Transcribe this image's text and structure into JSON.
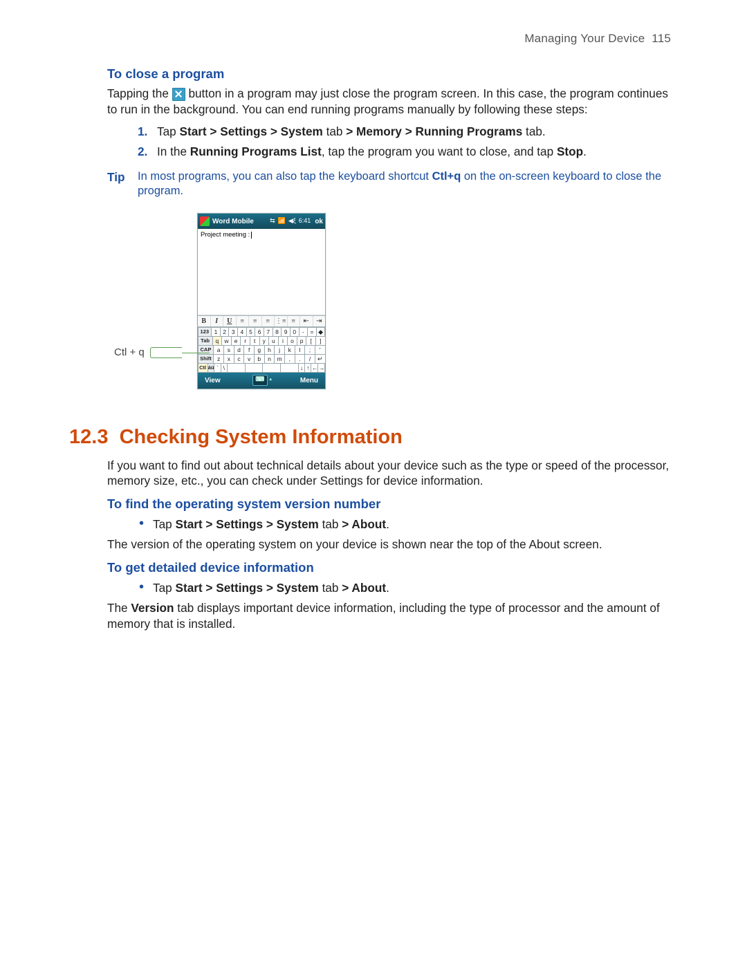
{
  "header": {
    "section": "Managing Your Device",
    "page_no": "115"
  },
  "s1": {
    "title": "To close a program",
    "para_a": "Tapping the ",
    "para_b": " button in a program may just close the program screen. In this case, the program continues to run in the background. You can end running programs manually by following these steps:",
    "steps": [
      {
        "n": "1.",
        "pre": "Tap ",
        "b1": "Start > Settings > System",
        "mid": " tab ",
        "b2": "> Memory > Running Programs",
        "post": " tab."
      },
      {
        "n": "2.",
        "pre": "In the ",
        "b1": "Running Programs List",
        "mid": ", tap the program you want to close, and tap ",
        "b2": "Stop",
        "post": "."
      }
    ],
    "tip": {
      "label": "Tip",
      "pre": "In most programs, you can also tap the keyboard shortcut ",
      "b": "Ctl+q",
      "post": " on the on-screen keyboard to close the program."
    },
    "callout": "Ctl + q"
  },
  "device": {
    "title": "Word Mobile",
    "status_signal": "⇆",
    "status_bars": "📶",
    "status_vol": "◀ξ",
    "status_time": "6:41",
    "ok": "ok",
    "doc_text": "Project meeting :",
    "toolbar": {
      "b": "B",
      "i": "I",
      "u": "U",
      "al": "≡",
      "ac": "≡",
      "ar": "≡",
      "bl": "⋮≡",
      "nl": "≡",
      "ind_l": "⇤",
      "ind_r": "⇥"
    },
    "rows": {
      "r1": [
        "123",
        "1",
        "2",
        "3",
        "4",
        "5",
        "6",
        "7",
        "8",
        "9",
        "0",
        "-",
        "=",
        "◆"
      ],
      "r2": [
        "Tab",
        "q",
        "w",
        "e",
        "r",
        "t",
        "y",
        "u",
        "i",
        "o",
        "p",
        "[",
        "]"
      ],
      "r3": [
        "CAP",
        "a",
        "s",
        "d",
        "f",
        "g",
        "h",
        "j",
        "k",
        "l",
        ";",
        "'"
      ],
      "r4": [
        "Shift",
        "z",
        "x",
        "c",
        "v",
        "b",
        "n",
        "m",
        ",",
        ".",
        "/",
        "↵"
      ],
      "r5": [
        "Ctl",
        "áü",
        "`",
        "\\",
        "",
        "",
        "",
        "",
        "↓",
        "↑",
        "←",
        "→"
      ]
    },
    "menu": {
      "left": "View",
      "right": "Menu"
    }
  },
  "s2": {
    "num": "12.3",
    "title": "Checking System Information",
    "intro": "If you want to find out about technical details about your device such as the type or speed of the processor, memory size, etc., you can check under Settings for device information.",
    "a": {
      "title": "To find the operating system version number",
      "bullet": {
        "pre": "Tap ",
        "b1": "Start > Settings > System",
        "mid": " tab ",
        "b2": "> About",
        "post": "."
      },
      "para": "The version of the operating system on your device is shown near the top of the About screen."
    },
    "b": {
      "title": "To get detailed device information",
      "bullet": {
        "pre": "Tap ",
        "b1": "Start > Settings > System",
        "mid": " tab ",
        "b2": "> About",
        "post": "."
      },
      "para_a": "The ",
      "para_b": "Version",
      "para_c": " tab displays important device information, including the type of processor and the amount of memory that is installed."
    }
  }
}
